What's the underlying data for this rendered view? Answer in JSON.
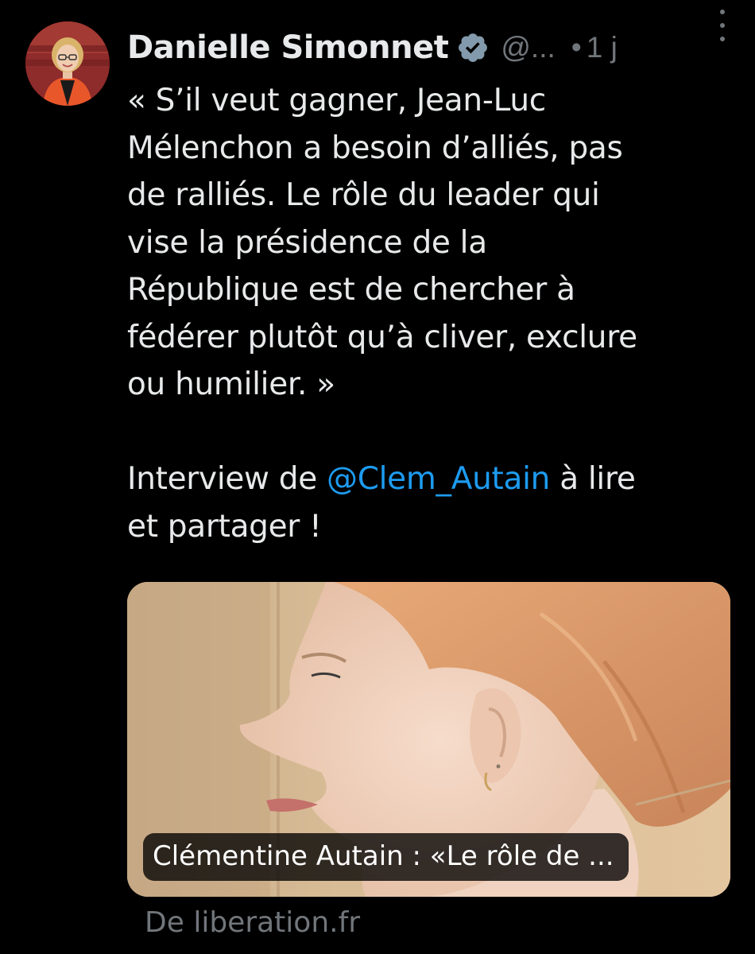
{
  "author": {
    "display_name": "Danielle Simonnet",
    "handle": "@...",
    "separator": "•",
    "time": "1 j",
    "verified_icon": "verified-badge-icon",
    "avatar_icon": "avatar-photo"
  },
  "tweet": {
    "quote": "« S’il veut gagner, Jean-Luc\nMélenchon a besoin d’alliés, pas\nde ralliés. Le rôle du leader qui\nvise la présidence de la\nRépublique est de chercher à\nfédérer plutôt qu’à cliver, exclure\nou humilier. »",
    "line2_prefix": "Interview de ",
    "mention": "@Clem_Autain",
    "line2_suffix": " à lire\net partager !"
  },
  "card": {
    "title": "Clémentine Autain : «Le rôle de ...",
    "source": "De liberation.fr"
  },
  "colors": {
    "background": "#000000",
    "text": "#e7e9ea",
    "muted": "#71767b",
    "link": "#1d9bf0",
    "verified": "#829aab"
  }
}
